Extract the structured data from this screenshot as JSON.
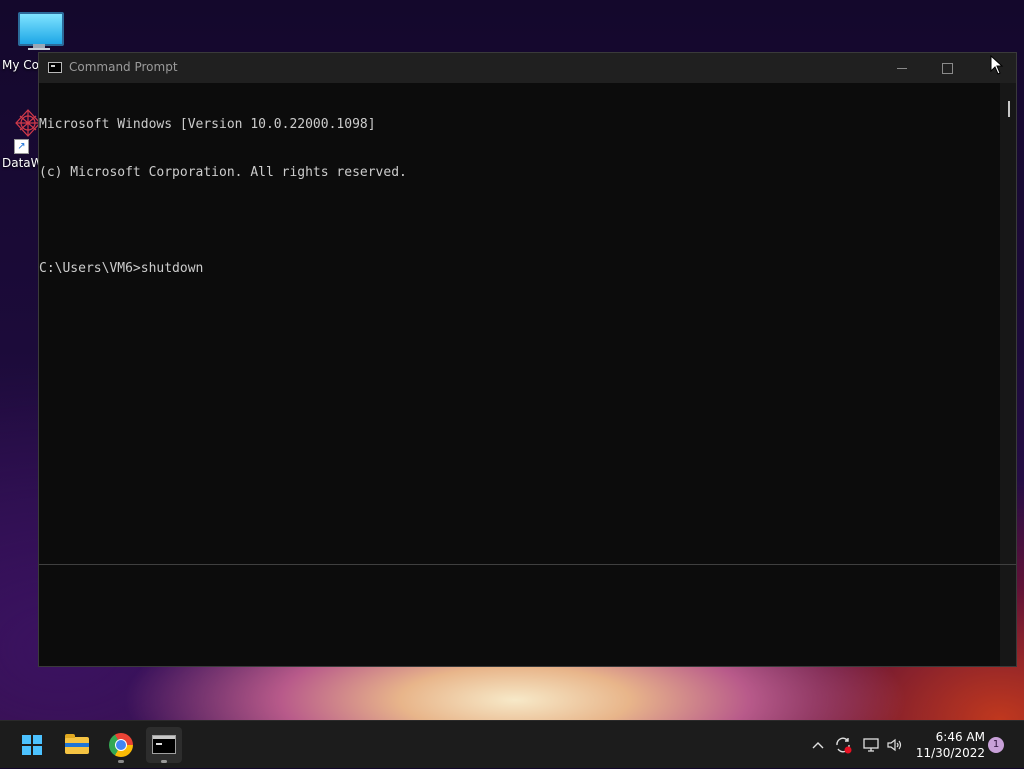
{
  "desktop": {
    "icons": [
      {
        "label": "My Co",
        "icon": "monitor-icon"
      },
      {
        "label": "DataW",
        "icon": "datawrapper-icon"
      }
    ]
  },
  "window": {
    "title": "Command Prompt",
    "icon": "cmd-icon",
    "controls": {
      "minimize": "minimize-icon",
      "maximize": "maximize-icon",
      "close": "close-icon"
    }
  },
  "console": {
    "lines": [
      "Microsoft Windows [Version 10.0.22000.1098]",
      "(c) Microsoft Corporation. All rights reserved.",
      "",
      "C:\\Users\\VM6>shutdown"
    ]
  },
  "taskbar": {
    "apps": [
      {
        "name": "Start",
        "icon": "windows-start-icon"
      },
      {
        "name": "File Explorer",
        "icon": "folder-icon"
      },
      {
        "name": "Google Chrome",
        "icon": "chrome-icon",
        "running": true
      },
      {
        "name": "Command Prompt",
        "icon": "cmd-icon",
        "running": true
      }
    ],
    "tray": {
      "chevron": "^",
      "clock_time": "6:46 AM",
      "clock_date": "11/30/2022",
      "notification_count": "1"
    }
  },
  "colors": {
    "console_bg": "#0c0c0c",
    "console_text": "#cccccc",
    "titlebar_bg": "#202020",
    "taskbar_bg": "#1c1c1c",
    "accent": "#4cc2ff"
  }
}
